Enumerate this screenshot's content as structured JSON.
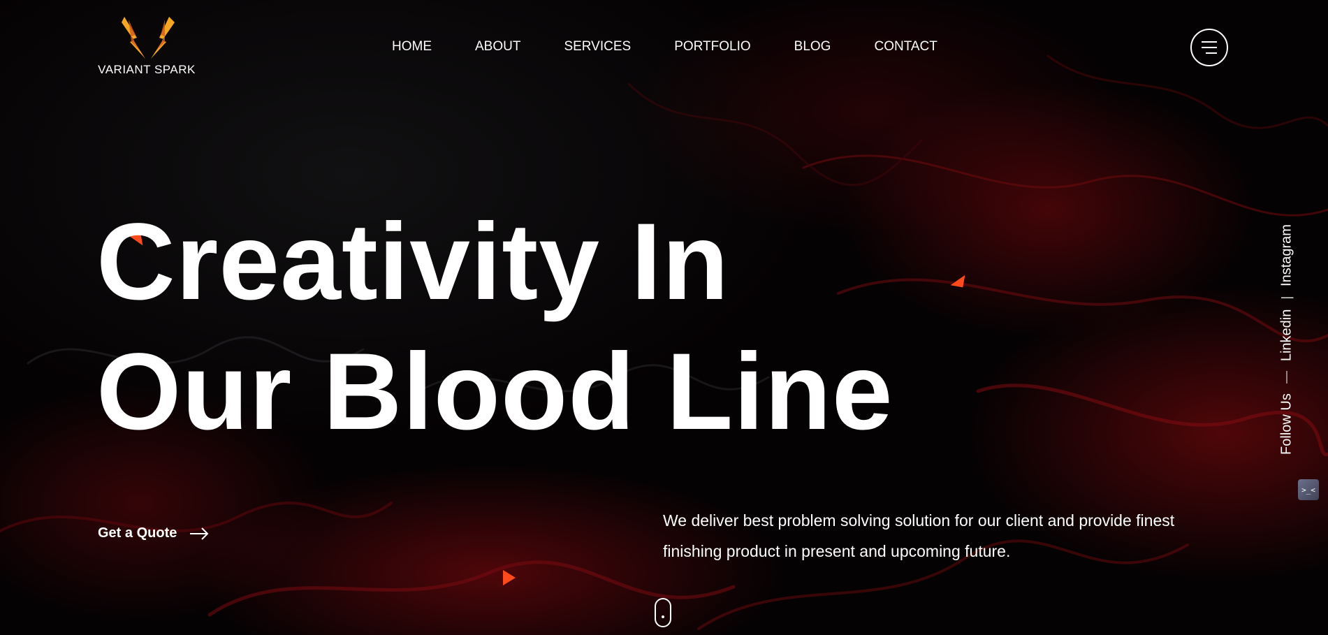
{
  "brand": {
    "name": "VARIANT SPARK",
    "logo_icon": "twin-lightning-bolts-icon"
  },
  "nav": {
    "items": [
      {
        "label": "HOME"
      },
      {
        "label": "ABOUT"
      },
      {
        "label": "SERVICES"
      },
      {
        "label": "PORTFOLIO"
      },
      {
        "label": "BLOG"
      },
      {
        "label": "CONTACT"
      }
    ],
    "menu_icon": "hamburger-menu-icon"
  },
  "hero": {
    "headline_line1": "Creativity In",
    "headline_line2": "Our Blood Line",
    "cta_label": "Get a Quote",
    "cta_icon": "arrow-right-icon",
    "tagline": "We deliver best problem solving solution for our client and provide finest finishing product in present and upcoming future."
  },
  "social": {
    "follow_label": "Follow Us",
    "links": [
      {
        "label": "Linkedin"
      },
      {
        "label": "Instagram"
      }
    ]
  },
  "widgets": {
    "chat_glyph": ">_<",
    "scroll_icon": "mouse-scroll-icon"
  },
  "colors": {
    "background": "#050203",
    "accent_red": "#8c0a0e",
    "triangle_orange": "#ff4a1c",
    "logo_orange": "#f5a623",
    "text": "#ffffff"
  }
}
